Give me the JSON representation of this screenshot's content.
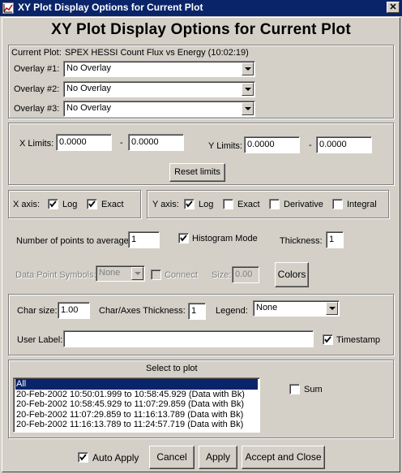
{
  "window": {
    "title": "XY Plot Display Options for Current Plot",
    "close_glyph": "✕"
  },
  "heading": "XY Plot Display Options for Current Plot",
  "overlays": {
    "current_plot_label": "Current Plot:",
    "current_plot_value": "SPEX HESSI Count Flux vs Energy (10:02:19)",
    "overlay1_label": "Overlay #1:",
    "overlay1_value": "No Overlay",
    "overlay2_label": "Overlay #2:",
    "overlay2_value": "No Overlay",
    "overlay3_label": "Overlay #3:",
    "overlay3_value": "No Overlay"
  },
  "limits": {
    "x_label": "X Limits:",
    "x_min": "0.0000",
    "x_max": "0.0000",
    "y_label": "Y Limits:",
    "y_min": "0.0000",
    "y_max": "0.0000",
    "dash": "-",
    "reset_label": "Reset limits"
  },
  "xaxis": {
    "label": "X axis:",
    "log_label": "Log",
    "log_checked": true,
    "exact_label": "Exact",
    "exact_checked": true
  },
  "yaxis": {
    "label": "Y axis:",
    "log_label": "Log",
    "log_checked": true,
    "exact_label": "Exact",
    "exact_checked": false,
    "derivative_label": "Derivative",
    "derivative_checked": false,
    "integral_label": "Integral",
    "integral_checked": false
  },
  "points": {
    "average_label": "Number of points to average:",
    "average_value": "1",
    "histogram_label": "Histogram Mode",
    "histogram_checked": true,
    "thickness_label": "Thickness:",
    "thickness_value": "1",
    "symbols_label": "Data Point Symbols:",
    "symbols_value": "None",
    "connect_label": "Connect",
    "connect_checked": false,
    "size_label": "Size:",
    "size_value": "0.00",
    "colors_label": "Colors"
  },
  "text": {
    "charsize_label": "Char size:",
    "charsize_value": "1.00",
    "charthick_label": "Char/Axes Thickness:",
    "charthick_value": "1",
    "legend_label": "Legend:",
    "legend_value": "None",
    "userlabel_label": "User Label:",
    "userlabel_value": "",
    "timestamp_label": "Timestamp",
    "timestamp_checked": true
  },
  "select": {
    "title": "Select  to plot",
    "items": [
      "All",
      "20-Feb-2002 10:50:01.999 to 10:58:45.929 (Data with Bk)",
      "20-Feb-2002 10:58:45.929 to 11:07:29.859 (Data with Bk)",
      "20-Feb-2002 11:07:29.859 to 11:16:13.789 (Data with Bk)",
      "20-Feb-2002 11:16:13.789 to 11:24:57.719 (Data with Bk)"
    ],
    "selected_index": 0,
    "sum_label": "Sum",
    "sum_checked": false
  },
  "footer": {
    "auto_apply_label": "Auto Apply",
    "auto_apply_checked": true,
    "cancel_label": "Cancel",
    "apply_label": "Apply",
    "accept_label": "Accept and Close"
  },
  "colors": {
    "titlebar": "#0a246a",
    "face": "#d4d0c8",
    "selection": "#0a246a"
  }
}
